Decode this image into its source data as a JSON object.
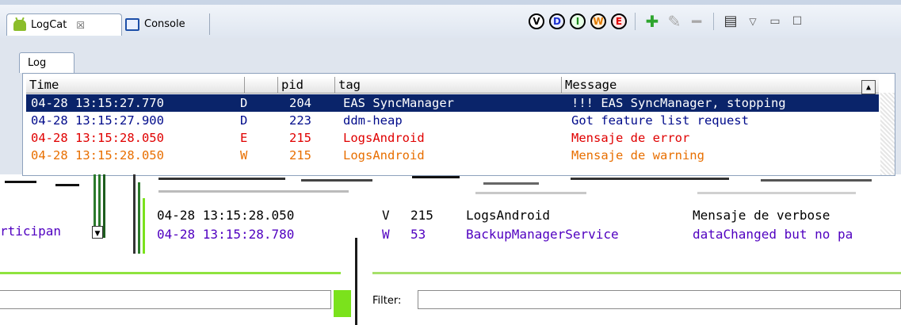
{
  "tabs": [
    {
      "label": "LogCat",
      "close": "☒",
      "icon": "android-icon",
      "active": true
    },
    {
      "label": "Console",
      "icon": "console-icon",
      "active": false
    }
  ],
  "toolbar": {
    "levels": [
      {
        "letter": "V",
        "color": "#000000"
      },
      {
        "letter": "D",
        "color": "#1a2fd0"
      },
      {
        "letter": "I",
        "color": "#1f8a1f"
      },
      {
        "letter": "W",
        "color": "#e07a00"
      },
      {
        "letter": "E",
        "color": "#e00000"
      }
    ],
    "actions": [
      "add-filter-icon",
      "edit-filter-icon",
      "remove-filter-icon",
      "clear-log-icon",
      "view-menu-icon",
      "minimize-icon",
      "maximize-icon"
    ]
  },
  "log_tab": {
    "label": "Log"
  },
  "columns": {
    "time": "Time",
    "level": "",
    "pid": "pid",
    "tag": "tag",
    "message": "Message"
  },
  "rows": [
    {
      "time": "04-28 13:15:27.770",
      "level": "D",
      "pid": "204",
      "tag": "EAS SyncManager",
      "message": "!!! EAS SyncManager, stopping",
      "selected": true,
      "color": "#ffffff"
    },
    {
      "time": "04-28 13:15:27.900",
      "level": "D",
      "pid": "223",
      "tag": "ddm-heap",
      "message": "Got feature list request",
      "selected": false,
      "color": "#000b8b"
    },
    {
      "time": "04-28 13:15:28.050",
      "level": "E",
      "pid": "215",
      "tag": "LogsAndroid",
      "message": "Mensaje de error",
      "selected": false,
      "color": "#e00000"
    },
    {
      "time": "04-28 13:15:28.050",
      "level": "W",
      "pid": "215",
      "tag": "LogsAndroid",
      "message": "Mensaje de warning",
      "selected": false,
      "color": "#e86f00"
    }
  ],
  "lower_rows": [
    {
      "time": "04-28 13:15:28.050",
      "level": "V",
      "pid": "215",
      "tag": "LogsAndroid",
      "message": "Mensaje de verbose",
      "color": "#000000"
    },
    {
      "time": "04-28 13:15:28.780",
      "level": "W",
      "pid": "53",
      "tag": "BackupManagerService",
      "message": "dataChanged but no pa",
      "color": "#5000c0"
    }
  ],
  "left_fragment": "rticipan",
  "filter": {
    "label": "Filter:",
    "value": ""
  }
}
